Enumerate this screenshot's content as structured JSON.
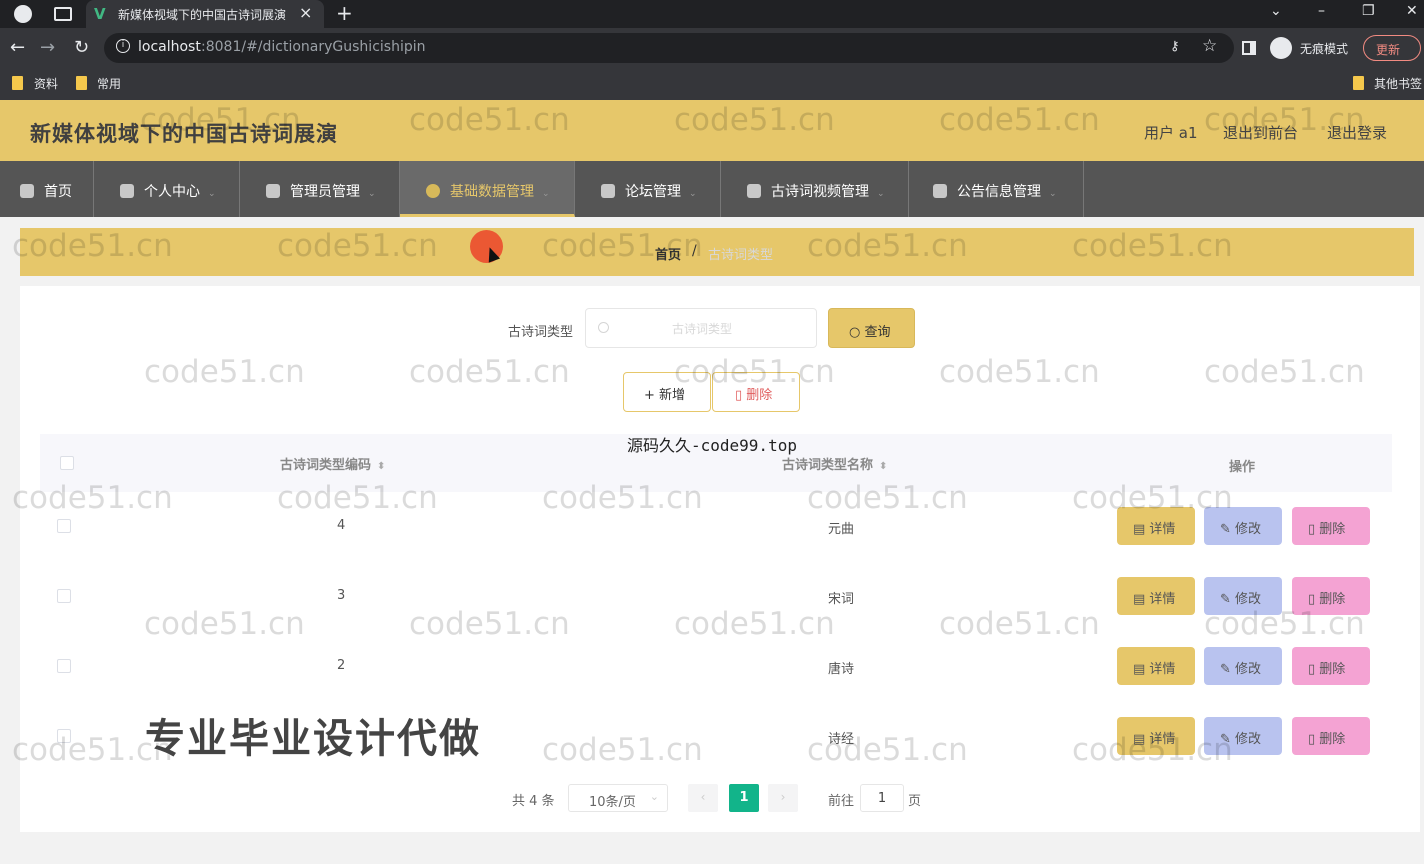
{
  "browser": {
    "tab_title": "新媒体视域下的中国古诗词展演",
    "url_host": "localhost",
    "url_rest": ":8081/#/dictionaryGushicishipin",
    "incognito_label": "无痕模式",
    "update_label": "更新",
    "bookmarks": [
      "资料",
      "常用"
    ],
    "other_bookmarks": "其他书签"
  },
  "header": {
    "title": "新媒体视域下的中国古诗词展演",
    "user_label": "用户 a1",
    "back_front_label": "退出到前台",
    "logout_label": "退出登录"
  },
  "nav": [
    {
      "label": "首页",
      "icon": "home-icon"
    },
    {
      "label": "个人中心",
      "icon": "user-icon"
    },
    {
      "label": "管理员管理",
      "icon": "send-icon"
    },
    {
      "label": "基础数据管理",
      "icon": "compass-icon"
    },
    {
      "label": "论坛管理",
      "icon": "doc-icon"
    },
    {
      "label": "古诗词视频管理",
      "icon": "phone-icon"
    },
    {
      "label": "公告信息管理",
      "icon": "globe-icon"
    }
  ],
  "breadcrumb": {
    "home": "首页",
    "separator": "/",
    "current": "古诗词类型"
  },
  "search": {
    "label": "古诗词类型",
    "placeholder": "古诗词类型",
    "query_label": "查询"
  },
  "actions": {
    "add_label": "新增",
    "delete_label": "删除"
  },
  "table": {
    "columns": [
      "古诗词类型编码",
      "古诗词类型名称",
      "操作"
    ],
    "rows": [
      {
        "code": "4",
        "name": "元曲"
      },
      {
        "code": "3",
        "name": "宋词"
      },
      {
        "code": "2",
        "name": "唐诗"
      },
      {
        "code": "",
        "name": "诗经"
      }
    ],
    "detail_label": "详情",
    "edit_label": "修改",
    "remove_label": "删除"
  },
  "pagination": {
    "total": "共 4 条",
    "page_size": "10条/页",
    "current_page": "1",
    "goto_label": "前往",
    "goto_value": "1",
    "page_label": "页"
  },
  "overlays": {
    "watermark": "code51.cn",
    "source_text": "源码久久-code99.top",
    "ad_text": "专业毕业设计代做"
  },
  "colors": {
    "accent": "#e6c76a",
    "nav_bg": "#555555",
    "page_active": "#12b48a",
    "edit_btn": "#b9c3ef",
    "remove_btn": "#f4a3d3"
  }
}
